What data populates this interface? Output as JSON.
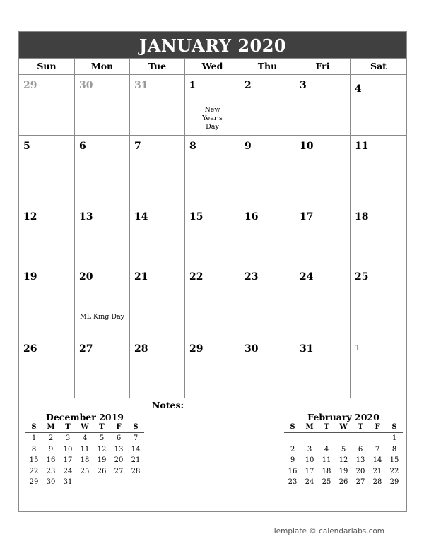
{
  "calendar": {
    "title": "JANUARY 2020",
    "weekdays": [
      "Sun",
      "Mon",
      "Tue",
      "Wed",
      "Thu",
      "Fri",
      "Sat"
    ],
    "weeks": [
      [
        {
          "day": "29",
          "other": true
        },
        {
          "day": "30",
          "other": true
        },
        {
          "day": "31",
          "other": true
        },
        {
          "day": "1",
          "event": "New Year's Day"
        },
        {
          "day": "2"
        },
        {
          "day": "3"
        },
        {
          "day": "4"
        }
      ],
      [
        {
          "day": "5"
        },
        {
          "day": "6"
        },
        {
          "day": "7"
        },
        {
          "day": "8"
        },
        {
          "day": "9"
        },
        {
          "day": "10"
        },
        {
          "day": "11"
        }
      ],
      [
        {
          "day": "12"
        },
        {
          "day": "13"
        },
        {
          "day": "14"
        },
        {
          "day": "15"
        },
        {
          "day": "16"
        },
        {
          "day": "17"
        },
        {
          "day": "18"
        }
      ],
      [
        {
          "day": "19"
        },
        {
          "day": "20",
          "event": "ML King Day"
        },
        {
          "day": "21"
        },
        {
          "day": "22"
        },
        {
          "day": "23"
        },
        {
          "day": "24"
        },
        {
          "day": "25"
        }
      ],
      [
        {
          "day": "26"
        },
        {
          "day": "27"
        },
        {
          "day": "28"
        },
        {
          "day": "29"
        },
        {
          "day": "30"
        },
        {
          "day": "31"
        },
        {
          "day": "1",
          "other": true
        }
      ]
    ]
  },
  "notes": {
    "label": "Notes:"
  },
  "mini_calendars": {
    "prev": {
      "title": "December 2019",
      "headers": [
        "S",
        "M",
        "T",
        "W",
        "T",
        "F",
        "S"
      ],
      "days": [
        "1",
        "2",
        "3",
        "4",
        "5",
        "6",
        "7",
        "8",
        "9",
        "10",
        "11",
        "12",
        "13",
        "14",
        "15",
        "16",
        "17",
        "18",
        "19",
        "20",
        "21",
        "22",
        "23",
        "24",
        "25",
        "26",
        "27",
        "28",
        "29",
        "30",
        "31"
      ],
      "leading_blanks": 0
    },
    "next": {
      "title": "February 2020",
      "headers": [
        "S",
        "M",
        "T",
        "W",
        "T",
        "F",
        "S"
      ],
      "days": [
        "1",
        "2",
        "3",
        "4",
        "5",
        "6",
        "7",
        "8",
        "9",
        "10",
        "11",
        "12",
        "13",
        "14",
        "15",
        "16",
        "17",
        "18",
        "19",
        "20",
        "21",
        "22",
        "23",
        "24",
        "25",
        "26",
        "27",
        "28",
        "29"
      ],
      "leading_blanks": 6
    }
  },
  "footer": {
    "text": "Template © calendarlabs.com"
  }
}
